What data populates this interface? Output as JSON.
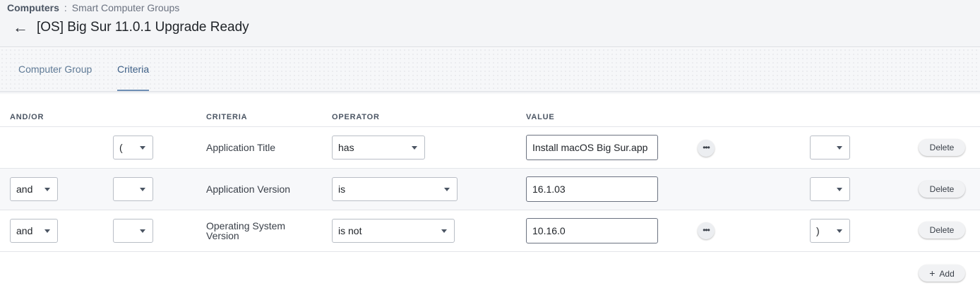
{
  "breadcrumb": {
    "root": "Computers",
    "separator": ":",
    "current": "Smart Computer Groups"
  },
  "header": {
    "back_icon": "arrow-left-icon",
    "title": "[OS] Big Sur 11.0.1 Upgrade Ready"
  },
  "tabs": [
    {
      "label": "Computer Group",
      "active": false
    },
    {
      "label": "Criteria",
      "active": true
    }
  ],
  "columns": {
    "andor": "AND/OR",
    "criteria": "CRITERIA",
    "operator": "OPERATOR",
    "value": "VALUE"
  },
  "rows": [
    {
      "andor": "",
      "open_paren": "(",
      "criteria": "Application Title",
      "operator": "has",
      "value": "Install macOS Big Sur.app",
      "show_more": true,
      "close_paren": "",
      "delete_label": "Delete"
    },
    {
      "andor": "and",
      "open_paren": "",
      "criteria": "Application Version",
      "operator": "is",
      "value": "16.1.03",
      "show_more": false,
      "close_paren": "",
      "delete_label": "Delete"
    },
    {
      "andor": "and",
      "open_paren": "",
      "criteria": "Operating System Version",
      "operator": "is not",
      "value": "10.16.0",
      "show_more": true,
      "close_paren": ")",
      "delete_label": "Delete"
    }
  ],
  "more_glyph": "•••",
  "add": {
    "plus": "+",
    "label": "Add"
  }
}
